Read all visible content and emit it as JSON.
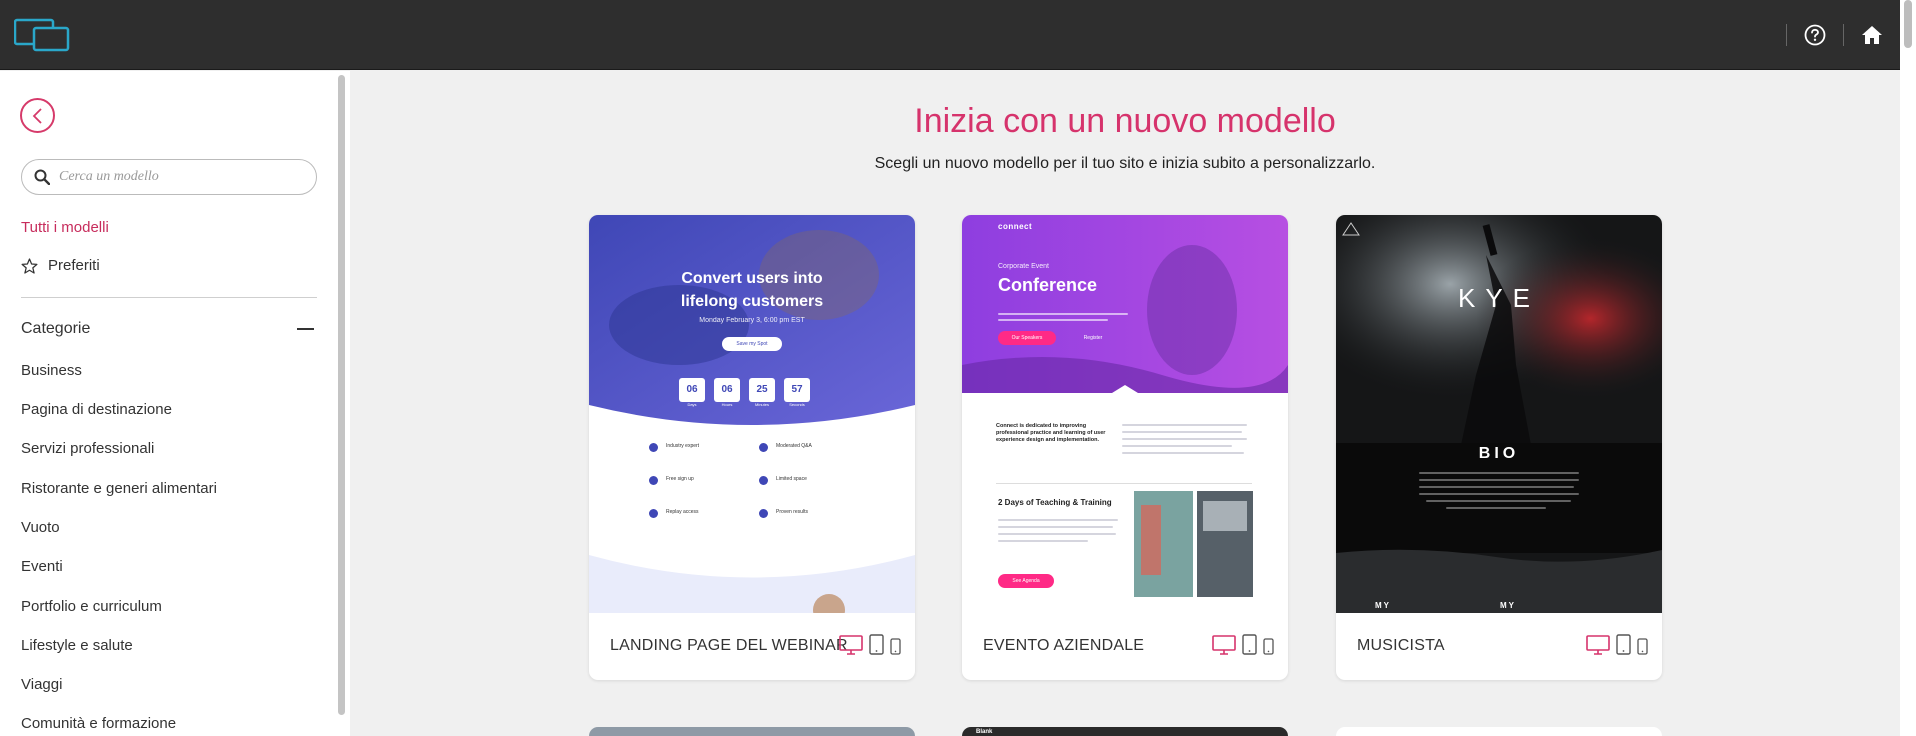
{
  "header": {
    "logo_icon": "devices-logo-icon",
    "help_icon": "question-circle-icon",
    "home_icon": "home-icon"
  },
  "sidebar": {
    "back_icon": "chevron-left-icon",
    "search_placeholder": "Cerca un modello",
    "all_templates": "Tutti i modelli",
    "favorites": "Preferiti",
    "categories_title": "Categorie",
    "categories": [
      "Business",
      "Pagina di destinazione",
      "Servizi professionali",
      "Ristorante e generi alimentari",
      "Vuoto",
      "Eventi",
      "Portfolio e curriculum",
      "Lifestyle e salute",
      "Viaggi",
      "Comunità e formazione"
    ]
  },
  "main": {
    "title": "Inizia con un nuovo modello",
    "subtitle": "Scegli un nuovo modello per il tuo sito e inizia subito a personalizzarlo.",
    "cards": [
      {
        "name": "LANDING PAGE DEL WEBINAR",
        "preview": {
          "headline_1": "Convert users into",
          "headline_2": "lifelong customers",
          "date": "Monday February 3, 6:00 pm EST",
          "button": "Save my Spot",
          "counters": [
            "06",
            "06",
            "25",
            "57"
          ],
          "counter_labels": [
            "Days",
            "Hours",
            "Minutes",
            "Seconds"
          ],
          "features": [
            "Industry expert",
            "Moderated Q&A",
            "Free sign up",
            "Limited space",
            "Replay access",
            "Proven results"
          ]
        }
      },
      {
        "name": "EVENTO AZIENDALE",
        "preview": {
          "brand": "connect",
          "kicker": "Corporate Event",
          "headline": "Conference",
          "btn_primary": "Our Speakers",
          "btn_secondary": "Register",
          "intro": "Connect is dedicated to improving professional practice and learning of user experience design and implementation.",
          "section_title": "2 Days of Teaching & Training",
          "btn_agenda": "See Agenda"
        }
      },
      {
        "name": "MUSICISTA",
        "preview": {
          "artist": "KYE",
          "section": "BIO",
          "footer_left": "MY",
          "footer_right": "MY"
        }
      }
    ],
    "peek_cards": [
      {
        "label": ""
      },
      {
        "label": "Blank"
      },
      {
        "label": ""
      }
    ],
    "accent_color": "#d6336c",
    "device_icons": [
      "desktop-icon",
      "tablet-icon",
      "phone-icon"
    ]
  }
}
